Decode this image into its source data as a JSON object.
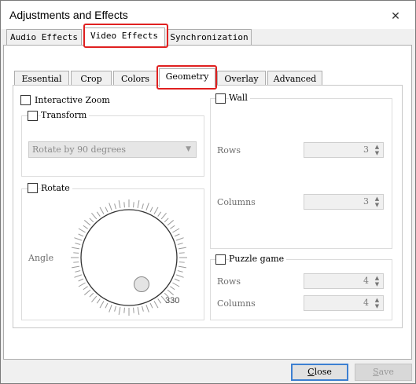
{
  "window": {
    "title": "Adjustments and Effects"
  },
  "top_tabs": [
    {
      "label": "Audio Effects"
    },
    {
      "label": "Video Effects"
    },
    {
      "label": "Synchronization"
    }
  ],
  "inner_tabs": [
    {
      "label": "Essential"
    },
    {
      "label": "Crop"
    },
    {
      "label": "Colors"
    },
    {
      "label": "Geometry"
    },
    {
      "label": "Overlay"
    },
    {
      "label": "Advanced"
    }
  ],
  "geometry": {
    "interactive_zoom": "Interactive Zoom",
    "transform": "Transform",
    "transform_select": "Rotate by 90 degrees",
    "rotate": "Rotate",
    "angle_label": "Angle",
    "angle_value": "330",
    "wall": "Wall",
    "wall_rows_label": "Rows",
    "wall_rows_value": "3",
    "wall_columns_label": "Columns",
    "wall_columns_value": "3",
    "puzzle": "Puzzle game",
    "puzzle_rows_label": "Rows",
    "puzzle_rows_value": "4",
    "puzzle_columns_label": "Columns",
    "puzzle_columns_value": "4"
  },
  "buttons": {
    "close_first": "C",
    "close_rest": "lose",
    "save_first": "S",
    "save_rest": "ave"
  },
  "colors": {
    "highlight": "#e02020",
    "default_button_border": "#3c7fd1"
  }
}
